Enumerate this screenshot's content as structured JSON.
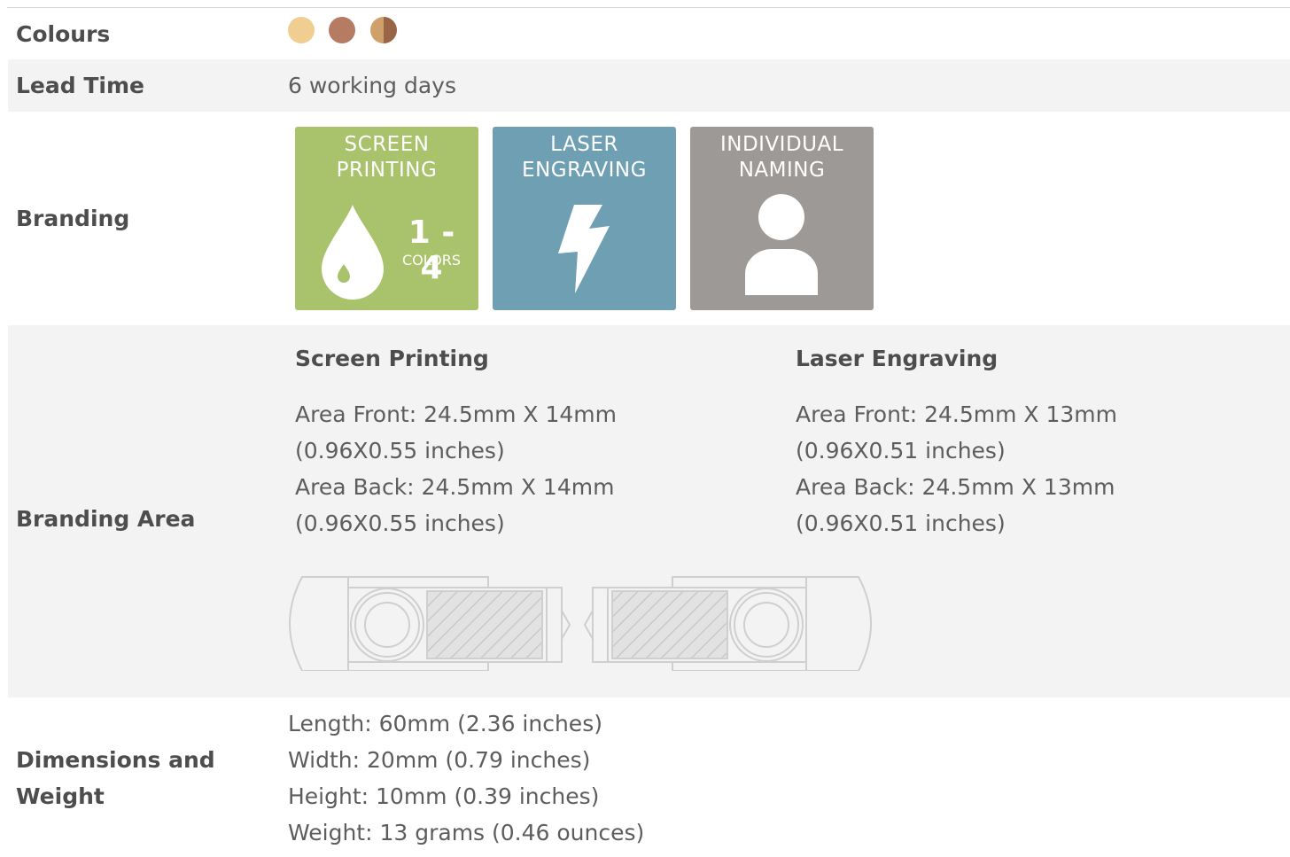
{
  "rows": {
    "colours": {
      "label": "Colours",
      "swatches": [
        "#f0cd90",
        "#b57c63",
        "#cfa06a",
        "#9a6546"
      ]
    },
    "lead_time": {
      "label": "Lead Time",
      "value": "6 working days"
    },
    "branding": {
      "label": "Branding",
      "tiles": [
        {
          "title_line1": "SCREEN",
          "title_line2": "PRINTING",
          "big": "1 - 4",
          "small": "COLORS",
          "color": "#a9c36c",
          "icon": "ink-drop-icon"
        },
        {
          "title_line1": "LASER",
          "title_line2": "ENGRAVING",
          "color": "#6e9fb3",
          "icon": "lightning-bolt-icon"
        },
        {
          "title_line1": "INDIVIDUAL",
          "title_line2": "NAMING",
          "color": "#9d9997",
          "icon": "person-icon"
        }
      ]
    },
    "branding_area": {
      "label": "Branding Area",
      "screen": {
        "heading": "Screen Printing",
        "front": "Area Front: 24.5mm X 14mm (0.96X0.55 inches)",
        "back": "Area Back: 24.5mm X 14mm (0.96X0.55 inches)"
      },
      "laser": {
        "heading": "Laser Engraving",
        "front": "Area Front: 24.5mm X 13mm (0.96X0.51 inches)",
        "back": "Area Back: 24.5mm X 13mm (0.96X0.51 inches)"
      }
    },
    "dimensions": {
      "label_line1": "Dimensions and",
      "label_line2": "Weight",
      "length": "Length: 60mm (2.36 inches)",
      "width": "Width: 20mm (0.79 inches)",
      "height": "Height: 10mm (0.39 inches)",
      "weight": "Weight: 13 grams (0.46 ounces)"
    }
  }
}
